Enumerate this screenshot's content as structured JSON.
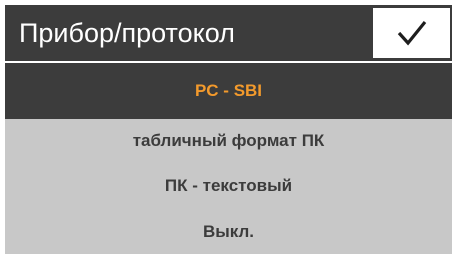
{
  "header": {
    "title": "Прибор/протокол",
    "confirm_icon": "check-icon"
  },
  "options": [
    {
      "label": "PC - SBI",
      "selected": true
    },
    {
      "label": "табличный формат ПК",
      "selected": false
    },
    {
      "label": "ПК - текстовый",
      "selected": false
    },
    {
      "label": "Выкл.",
      "selected": false
    }
  ],
  "colors": {
    "header_bg": "#3c3c3c",
    "list_bg": "#c8c8c8",
    "selected_text": "#f39a2c",
    "text": "#3c3c3c",
    "header_text": "#ffffff"
  }
}
